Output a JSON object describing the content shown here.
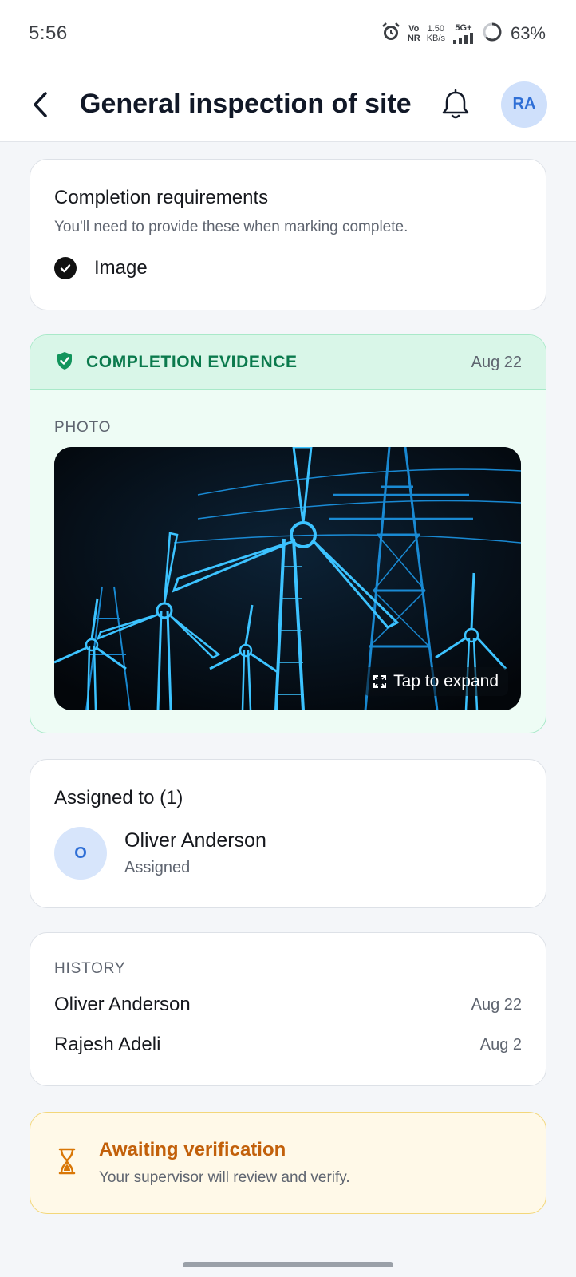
{
  "status_bar": {
    "time": "5:56",
    "volte_top": "Vo",
    "volte_bottom": "NR",
    "speed_value": "1.50",
    "speed_unit": "KB/s",
    "network": "5G+",
    "battery": "63%",
    "icons": [
      "alarm-icon",
      "signal-icon",
      "battery-icon"
    ]
  },
  "header": {
    "title": "General inspection of site",
    "avatar_initials": "RA",
    "icons": [
      "back-arrow-icon",
      "bell-icon"
    ]
  },
  "requirements": {
    "title": "Completion requirements",
    "subtitle": "You'll need to provide these when marking complete.",
    "items": [
      {
        "label": "Image",
        "checked": true
      }
    ]
  },
  "evidence": {
    "title": "COMPLETION EVIDENCE",
    "date": "Aug 22",
    "photo_label": "PHOTO",
    "expand_label": "Tap to expand",
    "icons": [
      "shield-check-icon",
      "expand-icon"
    ]
  },
  "assigned": {
    "title": "Assigned to (1)",
    "assignees": [
      {
        "initial": "O",
        "name": "Oliver Anderson",
        "role": "Assigned"
      }
    ]
  },
  "history": {
    "label": "HISTORY",
    "entries": [
      {
        "name": "Oliver Anderson",
        "date": "Aug 22"
      },
      {
        "name": "Rajesh Adeli",
        "date": "Aug 2"
      }
    ]
  },
  "awaiting": {
    "title": "Awaiting verification",
    "subtitle": "Your supervisor will review and verify.",
    "icon": "hourglass-icon"
  },
  "colors": {
    "accent_green": "#0b7a4d",
    "evidence_bg": "#eefcf5",
    "awaiting_orange": "#c2600a",
    "awaiting_bg": "#fff9e8",
    "avatar_blue": "#2f6fd6"
  }
}
